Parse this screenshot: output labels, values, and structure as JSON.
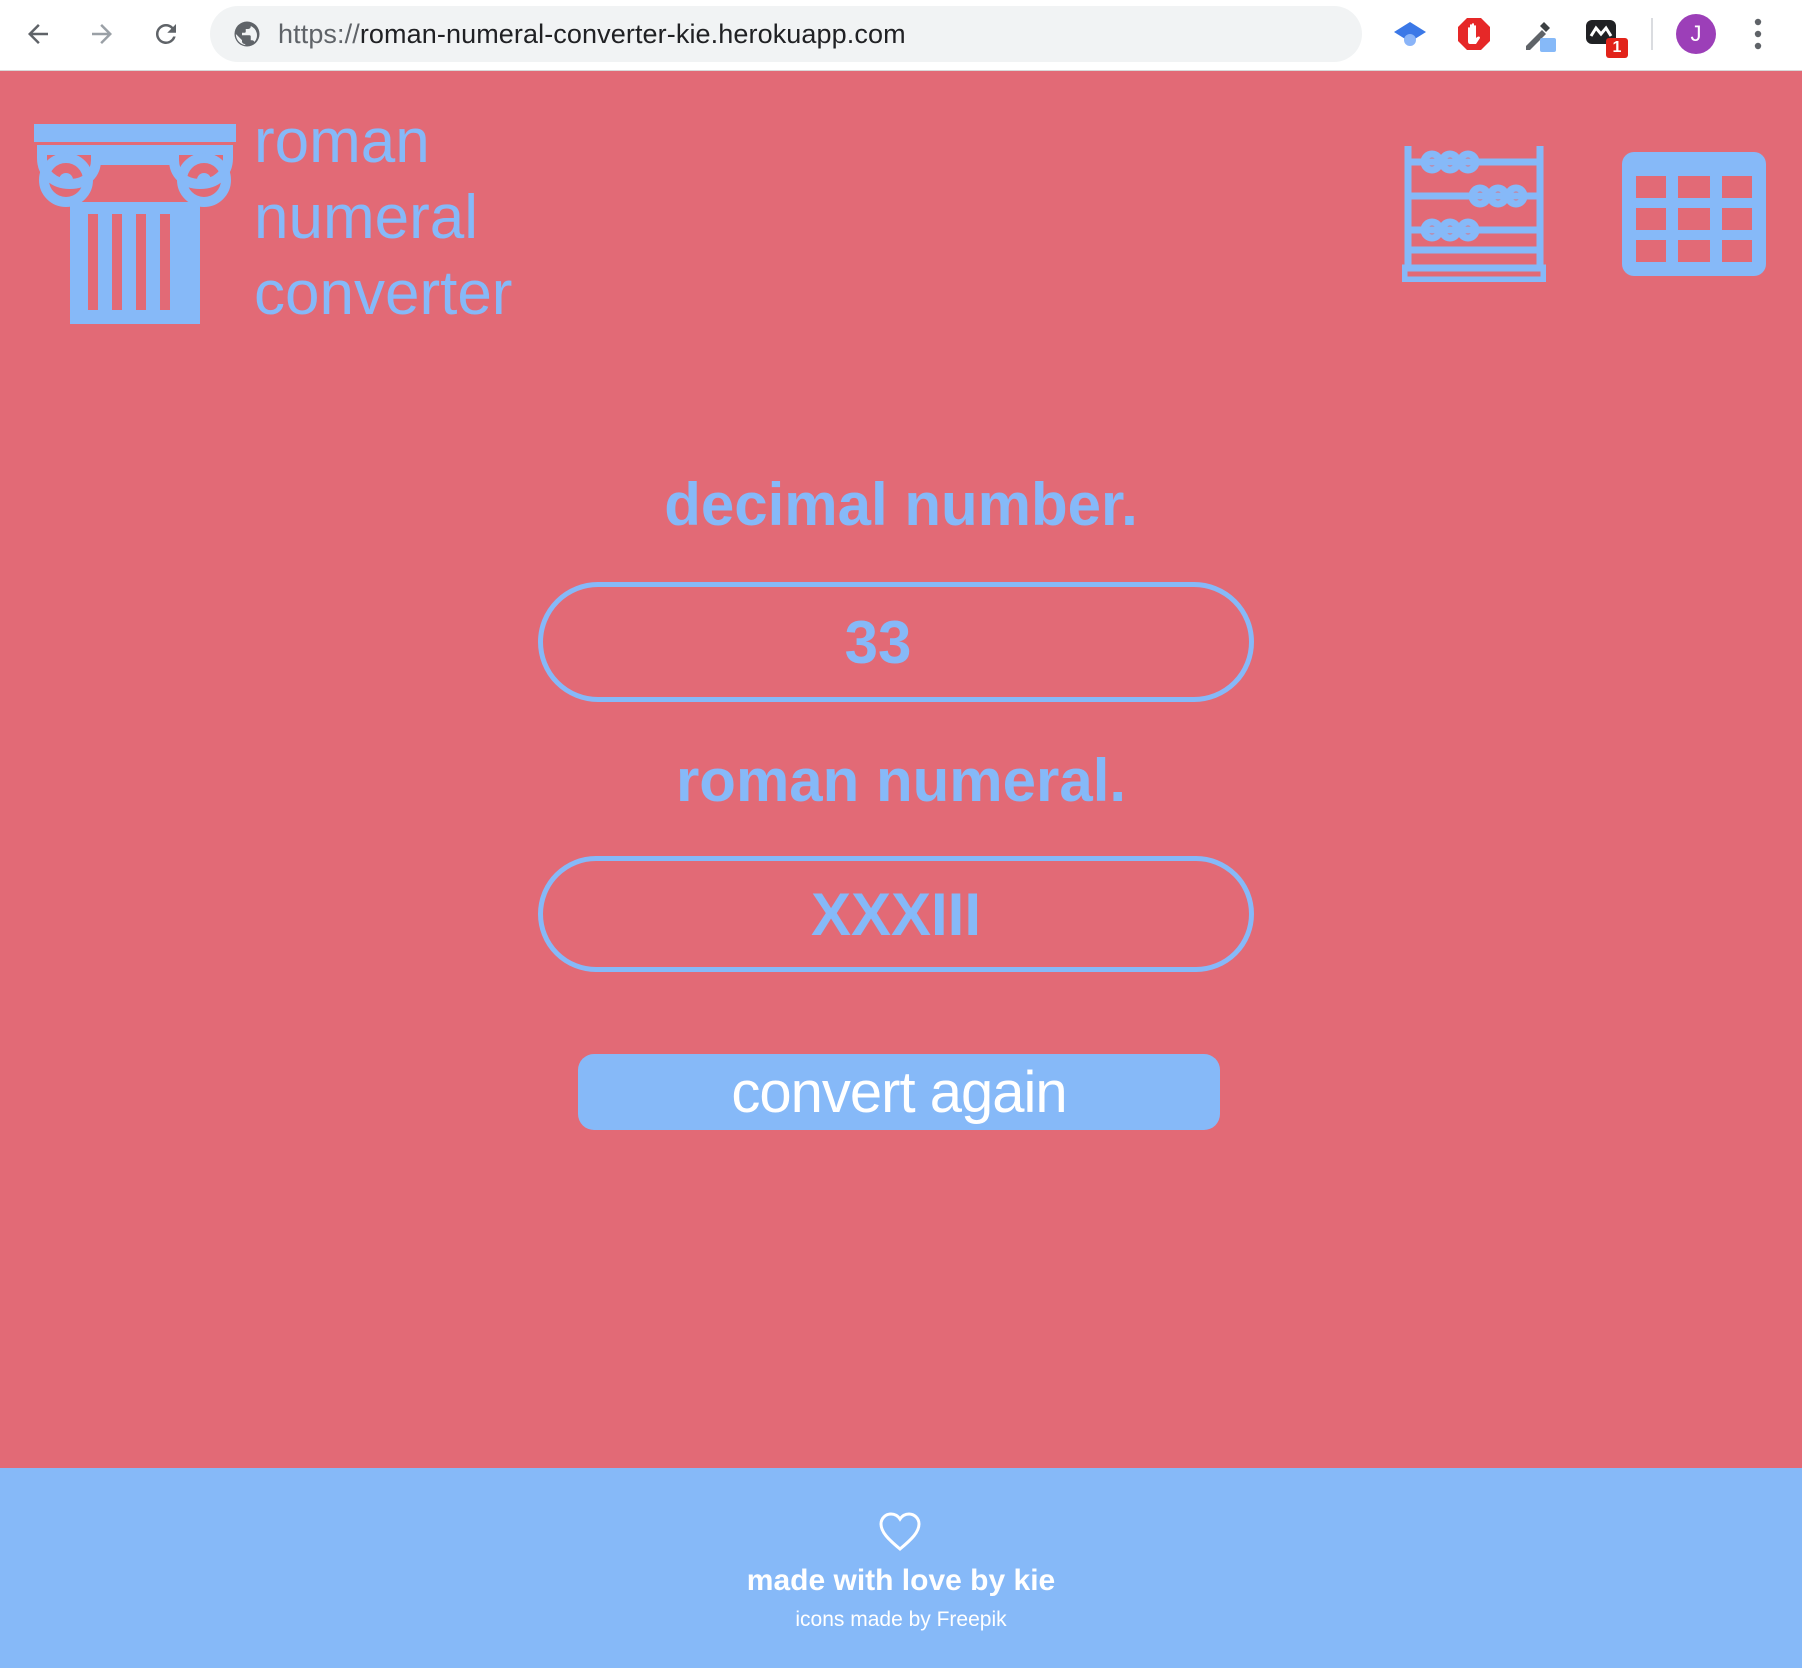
{
  "browser": {
    "url_scheme": "https://",
    "url_host": "roman-numeral-converter-kie.herokuapp.com",
    "avatar_letter": "J",
    "extension_badge": "1"
  },
  "logo": {
    "lines": [
      "roman",
      "numeral",
      "converter"
    ]
  },
  "form": {
    "decimal_label": "decimal number.",
    "decimal_value": "33",
    "roman_label": "roman numeral.",
    "roman_value": "XXXIII",
    "convert_button": "convert again"
  },
  "footer": {
    "main": "made with love by kie",
    "credit": "icons made by Freepik"
  },
  "colors": {
    "background": "#e26a76",
    "accent": "#86b9f8",
    "footer_bg": "#86b9f8"
  }
}
